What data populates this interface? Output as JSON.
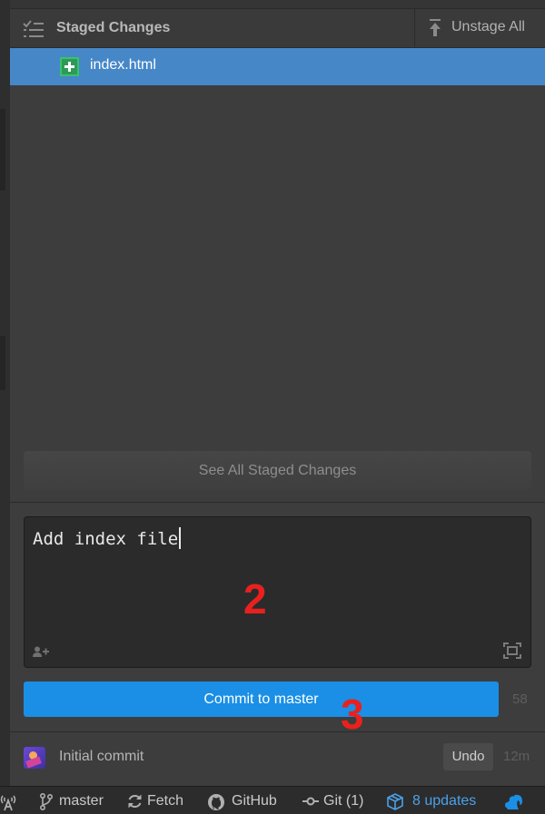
{
  "staged_panel": {
    "title": "Staged Changes",
    "unstage_all_label": "Unstage All",
    "files": [
      {
        "name": "index.html",
        "status": "added",
        "status_color": "#39c26a"
      }
    ],
    "see_all_label": "See All Staged Changes"
  },
  "commit": {
    "message": "Add index file",
    "button_label": "Commit to master",
    "remaining_chars": "58",
    "annotations": [
      "2",
      "3"
    ]
  },
  "last_commit": {
    "title": "Initial commit",
    "undo_label": "Undo",
    "age": "12m"
  },
  "status_bar": {
    "branch": "master",
    "fetch_label": "Fetch",
    "github_label": "GitHub",
    "git_label": "Git (1)",
    "updates_label": "8 updates"
  },
  "colors": {
    "selected_row": "#4687c8",
    "commit_button": "#1a8fe5",
    "annotation": "#e8211f",
    "updates_link": "#4aa1ea"
  },
  "icons": {
    "staged_header": "staged-changes-icon",
    "unstage": "unstage-arrow-icon",
    "file_status": "file-added-icon",
    "coauthor": "add-coauthor-icon",
    "expand": "expand-editor-icon",
    "status_left": "broadcast-icon",
    "branch": "git-branch-icon",
    "fetch": "sync-icon",
    "github": "github-icon",
    "git": "git-commit-icon",
    "updates": "package-icon",
    "squirrel": "squirrel-icon"
  }
}
